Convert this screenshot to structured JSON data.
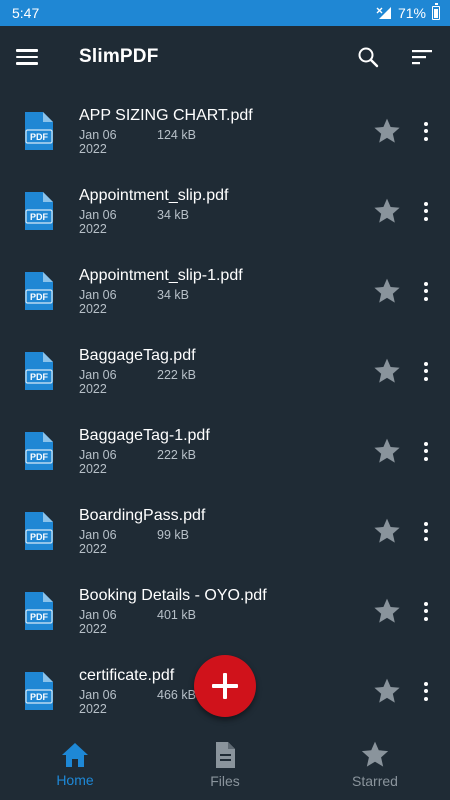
{
  "status_bar": {
    "time": "5:47",
    "battery": "71%"
  },
  "app_bar": {
    "title": "SlimPDF",
    "actions": [
      "search-icon",
      "sort-icon"
    ]
  },
  "files": [
    {
      "name": "APP SIZING CHART.pdf",
      "date": "Jan 06 2022",
      "size": "124 kB"
    },
    {
      "name": "Appointment_slip.pdf",
      "date": "Jan 06 2022",
      "size": "34 kB"
    },
    {
      "name": "Appointment_slip-1.pdf",
      "date": "Jan 06 2022",
      "size": "34 kB"
    },
    {
      "name": "BaggageTag.pdf",
      "date": "Jan 06 2022",
      "size": "222 kB"
    },
    {
      "name": "BaggageTag-1.pdf",
      "date": "Jan 06 2022",
      "size": "222 kB"
    },
    {
      "name": "BoardingPass.pdf",
      "date": "Jan 06 2022",
      "size": "99 kB"
    },
    {
      "name": "Booking Details - OYO.pdf",
      "date": "Jan 06 2022",
      "size": "401 kB"
    },
    {
      "name": "certificate.pdf",
      "date": "Jan 06 2022",
      "size": "466 kB"
    }
  ],
  "pdf_icon_label": "PDF",
  "bottom_nav": [
    {
      "label": "Home",
      "icon": "home-icon",
      "active": true
    },
    {
      "label": "Files",
      "icon": "file-icon",
      "active": false
    },
    {
      "label": "Starred",
      "icon": "star-icon",
      "active": false
    }
  ],
  "colors": {
    "background": "#1f2b35",
    "status_bar": "#1f87d4",
    "accent": "#1e88d6",
    "fab": "#d0121b",
    "pdf_icon": "#1f87d4",
    "star_inactive": "#8a949c"
  }
}
